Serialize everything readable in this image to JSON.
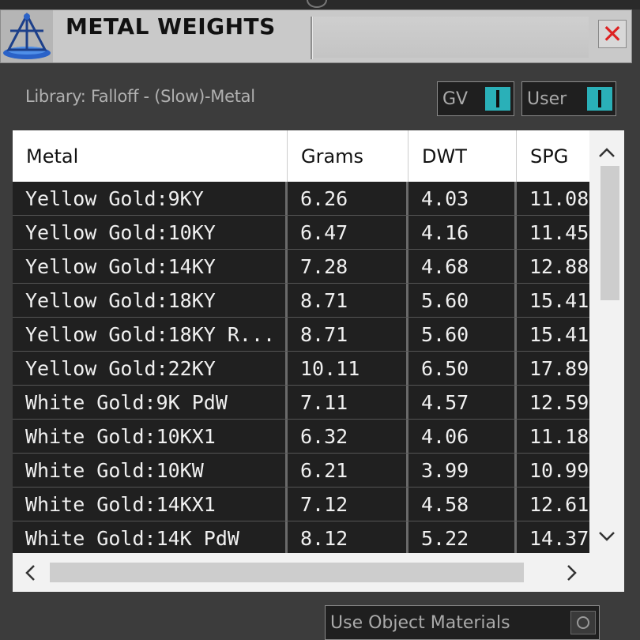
{
  "window": {
    "title": "METAL WEIGHTS",
    "close_glyph": "✕"
  },
  "library": {
    "label": "Library: Falloff - (Slow)-Metal"
  },
  "toggles": {
    "gv_label": "GV",
    "user_label": "User",
    "use_object_materials_label": "Use Object Materials",
    "accent_color": "#2ab0b8"
  },
  "table": {
    "columns": [
      "Metal",
      "Grams",
      "DWT",
      "SPG"
    ],
    "rows": [
      [
        "Yellow Gold:9KY",
        "6.26",
        "4.03",
        "11.08"
      ],
      [
        "Yellow Gold:10KY",
        "6.47",
        "4.16",
        "11.45"
      ],
      [
        "Yellow Gold:14KY",
        "7.28",
        "4.68",
        "12.88"
      ],
      [
        "Yellow Gold:18KY",
        "8.71",
        "5.60",
        "15.41"
      ],
      [
        "Yellow Gold:18KY R...",
        "8.71",
        "5.60",
        "15.41"
      ],
      [
        "Yellow Gold:22KY",
        "10.11",
        "6.50",
        "17.89"
      ],
      [
        "White Gold:9K PdW",
        "7.11",
        "4.57",
        "12.59"
      ],
      [
        "White Gold:10KX1",
        "6.32",
        "4.06",
        "11.18"
      ],
      [
        "White Gold:10KW",
        "6.21",
        "3.99",
        "10.99"
      ],
      [
        "White Gold:14KX1",
        "7.12",
        "4.58",
        "12.61"
      ],
      [
        "White Gold:14K PdW",
        "8.12",
        "5.22",
        "14.37"
      ]
    ]
  },
  "scrollbars": {
    "up": "^",
    "down": "v",
    "left": "<",
    "right": ">"
  }
}
